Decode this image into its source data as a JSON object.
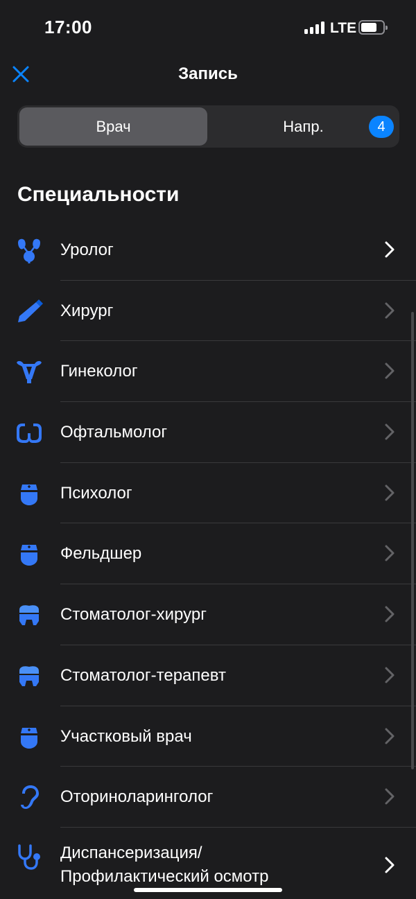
{
  "status_bar": {
    "time": "17:00",
    "network": "LTE",
    "battery_level": 0.65
  },
  "nav": {
    "title": "Запись",
    "close_icon": "close-icon"
  },
  "segment": {
    "active_label": "Врач",
    "inactive_label": "Напр.",
    "badge": "4"
  },
  "section_title": "Специальности",
  "colors": {
    "accent": "#0a84ff",
    "icon_blue": "#3478f6",
    "background": "#1c1c1e"
  },
  "specialties": [
    {
      "label": "Уролог",
      "icon": "kidneys-icon"
    },
    {
      "label": "Хирург",
      "icon": "scalpel-icon"
    },
    {
      "label": "Гинеколог",
      "icon": "uterus-icon"
    },
    {
      "label": "Офтальмолог",
      "icon": "glasses-icon"
    },
    {
      "label": "Психолог",
      "icon": "nurse-icon"
    },
    {
      "label": "Фельдшер",
      "icon": "nurse-icon"
    },
    {
      "label": "Стоматолог-хирург",
      "icon": "tooth-icon"
    },
    {
      "label": "Стоматолог-терапевт",
      "icon": "tooth-icon"
    },
    {
      "label": "Участковый врач",
      "icon": "nurse-icon"
    },
    {
      "label": "Оториноларинголог",
      "icon": "ear-icon"
    },
    {
      "label": "Диспансеризация/\nПрофилактический осмотр",
      "icon": "stethoscope-icon"
    }
  ]
}
